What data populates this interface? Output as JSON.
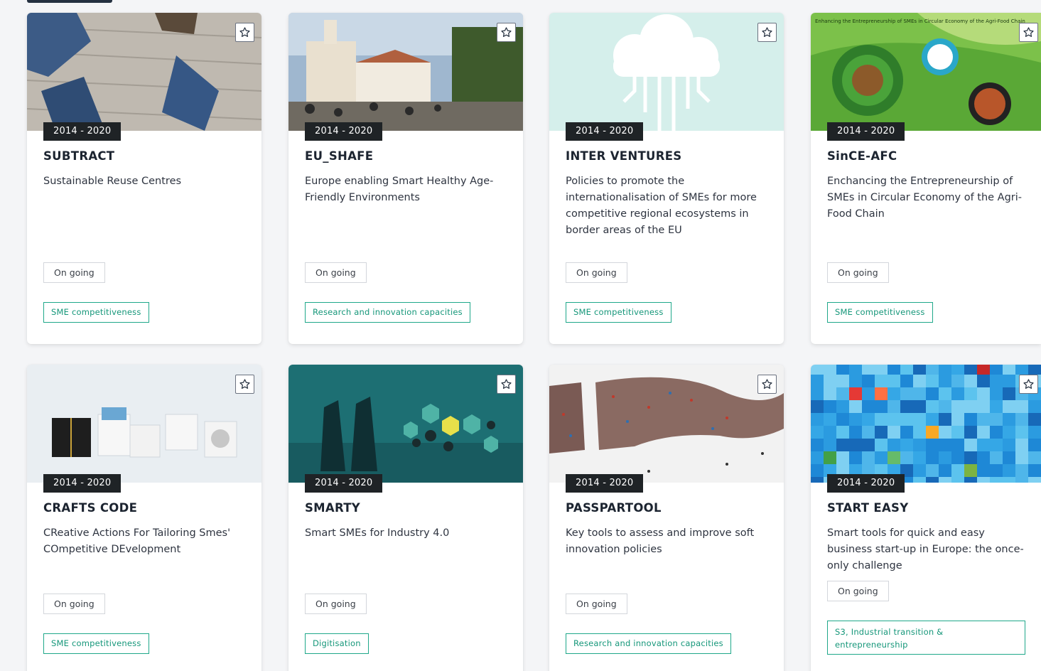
{
  "cards": [
    {
      "period": "2014 - 2020",
      "title": "SUBTRACT",
      "description": "Sustainable Reuse Centres",
      "status": "On going",
      "tag": "SME competitiveness"
    },
    {
      "period": "2014 - 2020",
      "title": "EU_SHAFE",
      "description": "Europe enabling Smart Healthy Age-Friendly Environments",
      "status": "On going",
      "tag": "Research and innovation capacities"
    },
    {
      "period": "2014 - 2020",
      "title": "INTER VENTURES",
      "description": "Policies to promote the internationalisation of SMEs for more competitive regional ecosystems in border areas of the EU",
      "status": "On going",
      "tag": "SME competitiveness"
    },
    {
      "period": "2014 - 2020",
      "title": "SinCE-AFC",
      "description": "Enchancing the Entrepreneurship of SMEs in Circular Economy of the Agri-Food Chain",
      "status": "On going",
      "tag": "SME competitiveness",
      "image_caption": "Enhancing the Entrepreneurship of SMEs in Circular Economy of the Agri-Food Chain"
    },
    {
      "period": "2014 - 2020",
      "title": "CRAFTS CODE",
      "description": "CReative Actions For Tailoring Smes' COmpetitive DEvelopment",
      "status": "On going",
      "tag": "SME competitiveness"
    },
    {
      "period": "2014 - 2020",
      "title": "SMARTY",
      "description": "Smart SMEs for Industry 4.0",
      "status": "On going",
      "tag": "Digitisation"
    },
    {
      "period": "2014 - 2020",
      "title": "PASSPARTOOL",
      "description": "Key tools to assess and improve soft innovation policies",
      "status": "On going",
      "tag": "Research and innovation capacities"
    },
    {
      "period": "2014 - 2020",
      "title": "START EASY",
      "description": "Smart tools for quick and easy business start-up in Europe: the once-only challenge",
      "status": "On going",
      "tag": "S3, Industrial transition & entrepreneurship"
    }
  ],
  "icons": {
    "favourite": "star-outline-icon"
  },
  "colors": {
    "tag_accent": "#1fa88a",
    "period_badge": "#1f2326"
  }
}
